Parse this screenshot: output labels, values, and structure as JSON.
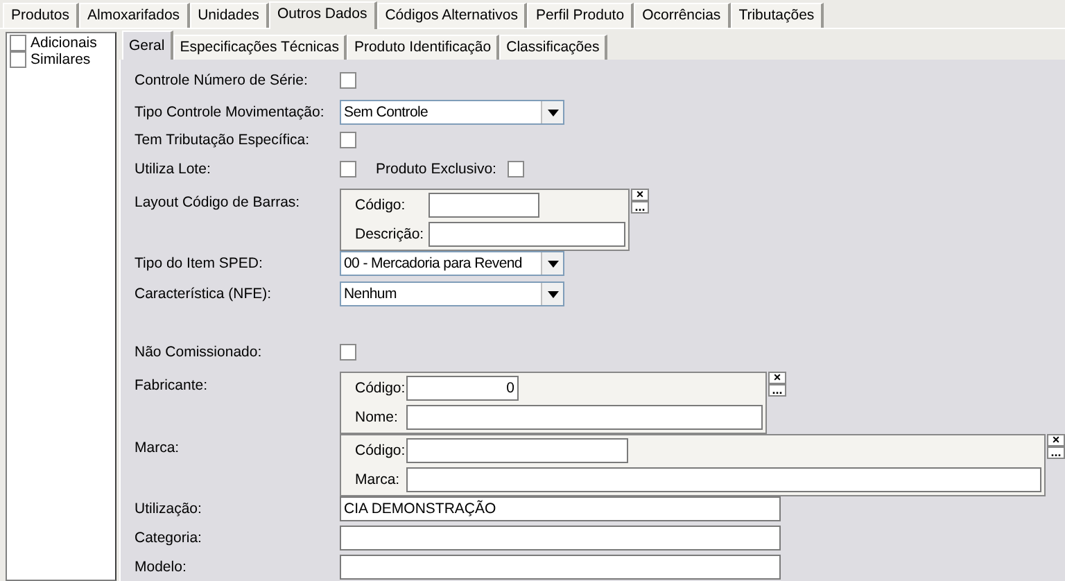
{
  "main_tabs": [
    {
      "label": "Produtos",
      "selected": false
    },
    {
      "label": "Almoxarifados",
      "selected": false
    },
    {
      "label": "Unidades",
      "selected": false
    },
    {
      "label": "Outros Dados",
      "selected": true
    },
    {
      "label": "Códigos Alternativos",
      "selected": false
    },
    {
      "label": "Perfil Produto",
      "selected": false
    },
    {
      "label": "Ocorrências",
      "selected": false
    },
    {
      "label": "Tributações",
      "selected": false
    }
  ],
  "side_list": [
    {
      "label": "Adicionais",
      "checked": false
    },
    {
      "label": "Similares",
      "checked": false
    }
  ],
  "sub_tabs": [
    {
      "label": "Geral",
      "selected": true
    },
    {
      "label": "Especificações Técnicas",
      "selected": false
    },
    {
      "label": "Produto Identificação",
      "selected": false
    },
    {
      "label": "Classificações",
      "selected": false
    }
  ],
  "form": [
    {
      "kind": "checkbox",
      "label": "Controle Número de Série:",
      "checked": false
    },
    {
      "kind": "select",
      "label": "Tipo Controle Movimentação:",
      "value": "Sem Controle"
    },
    {
      "kind": "checkbox",
      "label": "Tem Tributação Específica:",
      "checked": false
    },
    {
      "kind": "checkbox_pair",
      "label": "Utiliza Lote:",
      "checked": false,
      "second_label": "Produto Exclusivo:",
      "second_checked": false
    },
    {
      "kind": "lookup",
      "label": "Layout Código de Barras:",
      "fields": [
        {
          "label": "Código:"
        },
        {
          "label": "Descrição:"
        }
      ],
      "clear_button": "×",
      "browse_button": "..."
    },
    {
      "kind": "select",
      "label": "Tipo do Item SPED:",
      "value": "00 - Mercadoria para Revend"
    },
    {
      "kind": "select",
      "label": "Característica (NFE):",
      "value": "Nenhum"
    },
    {
      "kind": "checkbox",
      "label": "Não Comissionado:",
      "checked": false,
      "gap_before": true
    },
    {
      "kind": "lookup",
      "label": "Fabricante:",
      "fields": [
        {
          "label": "Código:",
          "value": "0",
          "numeric": true
        },
        {
          "label": "Nome:"
        }
      ],
      "clear_button": "×",
      "browse_button": "..."
    },
    {
      "kind": "lookup",
      "label": "Marca:",
      "fields": [
        {
          "label": "Código:"
        },
        {
          "label": "Marca:"
        }
      ],
      "clear_button": "×",
      "browse_button": "..."
    },
    {
      "kind": "text",
      "label": "Utilização:",
      "value": "CIA DEMONSTRAÇÃO"
    },
    {
      "kind": "text",
      "label": "Categoria:"
    },
    {
      "kind": "text",
      "label": "Modelo:"
    }
  ]
}
